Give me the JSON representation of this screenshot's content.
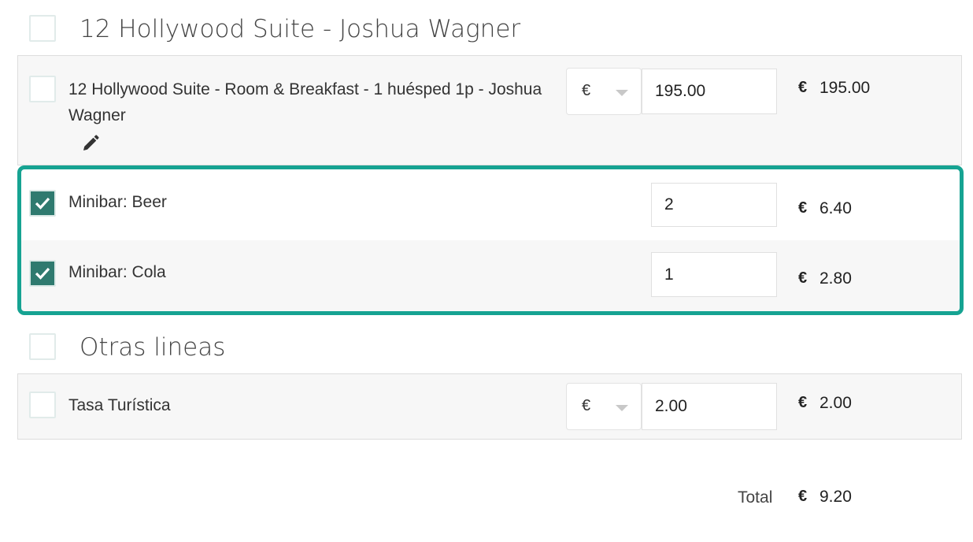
{
  "groups": [
    {
      "title": "12 Hollywood Suite - Joshua Wagner",
      "lines": [
        {
          "label": "12 Hollywood Suite - Room & Breakfast - 1 huésped 1p - Joshua Wagner",
          "currency_select": "€",
          "value": "195.00",
          "currency": "€",
          "amount": "195.00",
          "checked": false,
          "edit_icon": "pencil-icon"
        },
        {
          "label": "Minibar: Beer",
          "quantity": "2",
          "currency": "€",
          "amount": "6.40",
          "checked": true
        },
        {
          "label": "Minibar: Cola",
          "quantity": "1",
          "currency": "€",
          "amount": "2.80",
          "checked": true
        }
      ]
    },
    {
      "title": "Otras lineas",
      "lines": [
        {
          "label": "Tasa Turística",
          "currency_select": "€",
          "value": "2.00",
          "currency": "€",
          "amount": "2.00",
          "checked": false
        }
      ]
    }
  ],
  "total": {
    "label": "Total",
    "currency": "€",
    "amount": "9.20"
  },
  "colors": {
    "accent": "#16a392",
    "checkbox_checked": "#2f7a6f",
    "panel_bg": "#f7f7f7"
  },
  "icons": {
    "check": "check-icon",
    "dropdown": "chevron-down-icon",
    "edit": "pencil-icon"
  }
}
